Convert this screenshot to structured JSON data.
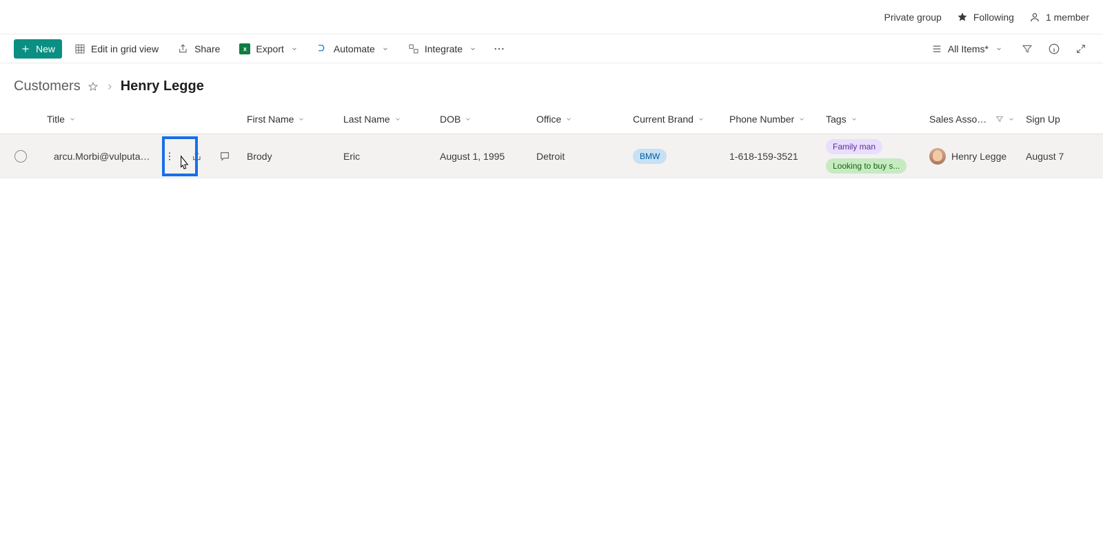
{
  "topbar": {
    "group_type": "Private group",
    "follow_label": "Following",
    "members": "1 member"
  },
  "cmd": {
    "new": "New",
    "edit_grid": "Edit in grid view",
    "share": "Share",
    "export": "Export",
    "automate": "Automate",
    "integrate": "Integrate"
  },
  "views": {
    "current": "All Items*"
  },
  "breadcrumb": {
    "root": "Customers",
    "current": "Henry Legge"
  },
  "cols": {
    "title": "Title",
    "first": "First Name",
    "last": "Last Name",
    "dob": "DOB",
    "office": "Office",
    "brand": "Current Brand",
    "phone": "Phone Number",
    "tags": "Tags",
    "sales": "Sales Associ...",
    "signup": "Sign Up"
  },
  "rows": [
    {
      "title": "arcu.Morbi@vulputatedui...",
      "first": "Brody",
      "last": "Eric",
      "dob": "August 1, 1995",
      "office": "Detroit",
      "brand": "BMW",
      "phone": "1-618-159-3521",
      "tags": [
        "Family man",
        "Looking to buy s..."
      ],
      "sales": "Henry Legge",
      "signup": "August 7"
    }
  ]
}
